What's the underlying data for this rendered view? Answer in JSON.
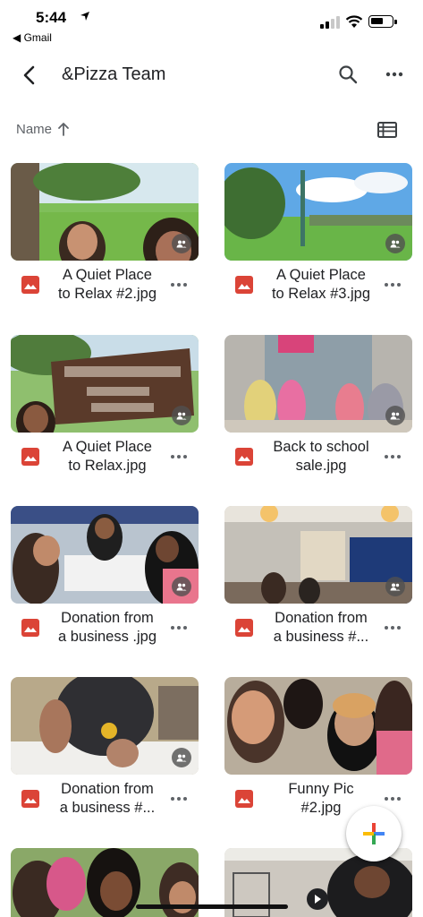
{
  "status_bar": {
    "time": "5:44",
    "back_app": "◀ Gmail"
  },
  "header": {
    "title": "&Pizza Team"
  },
  "sort": {
    "label": "Name"
  },
  "files": [
    {
      "name": "A Quiet Place\nto Relax #2.jpg",
      "type": "image",
      "shared": true
    },
    {
      "name": "A Quiet Place\nto Relax #3.jpg",
      "type": "image",
      "shared": true
    },
    {
      "name": "A Quiet Place\nto Relax.jpg",
      "type": "image",
      "shared": true
    },
    {
      "name": "Back to school\nsale.jpg",
      "type": "image",
      "shared": true
    },
    {
      "name": "Donation from\na business .jpg",
      "type": "image",
      "shared": true
    },
    {
      "name": "Donation from\na business #...",
      "type": "image",
      "shared": true
    },
    {
      "name": "Donation from\na business #...",
      "type": "image",
      "shared": true
    },
    {
      "name": "Funny Pic\n#2.jpg",
      "type": "image",
      "shared": false
    },
    {
      "name": "",
      "type": "image",
      "shared": false
    },
    {
      "name": "",
      "type": "video",
      "shared": false
    }
  ],
  "colors": {
    "image_file_icon": "#db4437",
    "fab_blue": "#4285f4",
    "fab_red": "#ea4335",
    "fab_yellow": "#fbbc04",
    "fab_green": "#34a853"
  },
  "icons": {
    "back": "arrow-back-icon",
    "search": "search-icon",
    "more": "more-horizontal-icon",
    "view": "list-view-icon",
    "sort": "arrow-up-icon",
    "shared": "people-icon",
    "file": "image-file-icon",
    "fab": "plus-icon"
  }
}
